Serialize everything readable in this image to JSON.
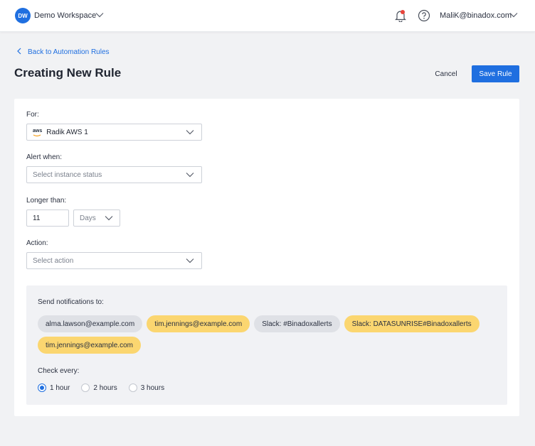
{
  "topbar": {
    "workspace_initials": "DW",
    "workspace_name": "Demo Workspace",
    "user_email": "MaliK@binadox.com",
    "notification_dot_color": "#e8433a"
  },
  "header": {
    "back_label": "Back to Automation Rules",
    "title": "Creating New Rule",
    "cancel_label": "Cancel",
    "save_label": "Save Rule"
  },
  "form": {
    "for_label": "For:",
    "for_value": "Radik AWS 1",
    "for_icon_text": "aws",
    "alert_label": "Alert when:",
    "alert_placeholder": "Select instance status",
    "longer_label": "Longer than:",
    "longer_value": "11",
    "longer_unit": "Days",
    "action_label": "Action:",
    "action_placeholder": "Select action"
  },
  "notifications": {
    "label": "Send notifications to:",
    "recipients": [
      {
        "text": "alma.lawson@example.com",
        "style": "grey"
      },
      {
        "text": "tim.jennings@example.com",
        "style": "yellow"
      },
      {
        "text": "Slack: #Binadoxallerts",
        "style": "grey"
      },
      {
        "text": "Slack: DATASUNRISE#Binadoxallerts",
        "style": "yellow"
      },
      {
        "text": "tim.jennings@example.com",
        "style": "yellow"
      }
    ],
    "check_label": "Check every:",
    "intervals": [
      {
        "label": "1 hour",
        "checked": true
      },
      {
        "label": "2 hours",
        "checked": false
      },
      {
        "label": "3 hours",
        "checked": false
      }
    ]
  },
  "colors": {
    "accent": "#1f6fe0",
    "chip_grey": "#dfe1e6",
    "chip_yellow": "#fbd670"
  }
}
